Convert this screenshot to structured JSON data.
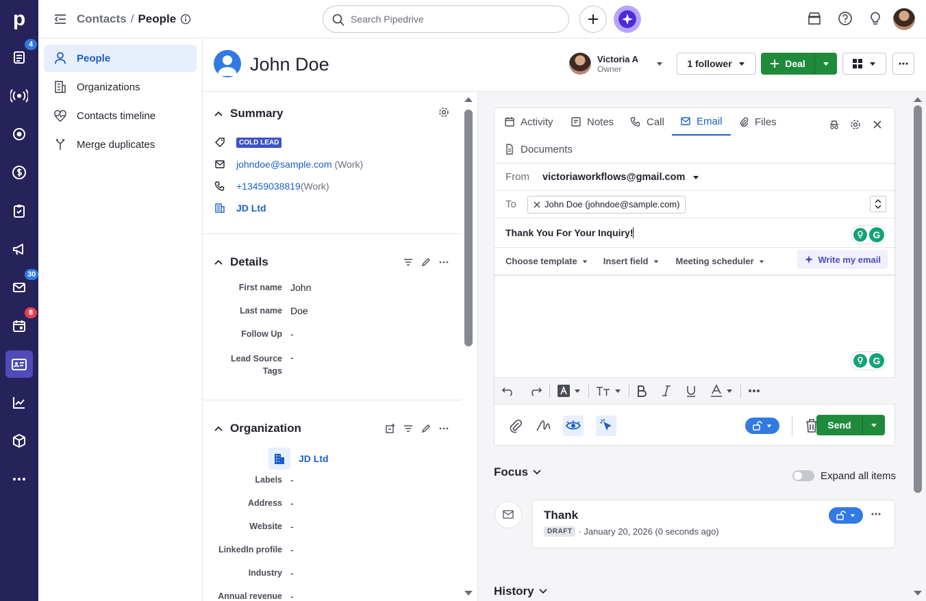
{
  "rail": {
    "logo": "p",
    "badges": {
      "deals": "4",
      "mail": "30",
      "calendar": "8"
    }
  },
  "topbar": {
    "crumb_root": "Contacts",
    "crumb_sep": "/",
    "crumb_current": "People",
    "search_placeholder": "Search Pipedrive"
  },
  "subnav": {
    "items": [
      {
        "label": "People"
      },
      {
        "label": "Organizations"
      },
      {
        "label": "Contacts timeline"
      },
      {
        "label": "Merge duplicates"
      }
    ]
  },
  "person": {
    "name": "John Doe",
    "owner_name": "Victoria A",
    "owner_role": "Owner",
    "follower_label": "1 follower",
    "deal_label": "Deal"
  },
  "summary": {
    "title": "Summary",
    "tag": "COLD LEAD",
    "email": "johndoe@sample.com",
    "email_type": "(Work)",
    "phone": "+13459038819",
    "phone_type": "(Work)",
    "org": "JD Ltd"
  },
  "details": {
    "title": "Details",
    "fields": [
      {
        "k": "First name",
        "v": "John"
      },
      {
        "k": "Last name",
        "v": "Doe"
      },
      {
        "k": "Follow Up",
        "v": "-"
      },
      {
        "k": "Lead Source Tags",
        "v": "-"
      }
    ]
  },
  "organization": {
    "title": "Organization",
    "name": "JD Ltd",
    "fields": [
      {
        "k": "Labels",
        "v": "-"
      },
      {
        "k": "Address",
        "v": "-"
      },
      {
        "k": "Website",
        "v": "-"
      },
      {
        "k": "LinkedIn profile",
        "v": "-"
      },
      {
        "k": "Industry",
        "v": "-"
      },
      {
        "k": "Annual revenue",
        "v": "-"
      }
    ]
  },
  "composer": {
    "tabs": [
      "Activity",
      "Notes",
      "Call",
      "Email",
      "Files",
      "Documents"
    ],
    "from_label": "From",
    "from_value": "victoriaworkflows@gmail.com",
    "to_label": "To",
    "to_chip": "John Doe (johndoe@sample.com)",
    "subject": "Thank You For Your Inquiry!",
    "choose_template": "Choose template",
    "insert_field": "Insert field",
    "meeting_scheduler": "Meeting scheduler",
    "write_my_email": "Write my email",
    "send_label": "Send"
  },
  "focus": {
    "title": "Focus",
    "expand_label": "Expand all items",
    "item_title": "Thank",
    "item_badge": "DRAFT",
    "item_meta": "· January 20, 2026 (0 seconds ago)"
  },
  "history": {
    "title": "History"
  },
  "colors": {
    "rail": "#26235a",
    "accent": "#1a5fc8",
    "green": "#1f8a3c"
  }
}
